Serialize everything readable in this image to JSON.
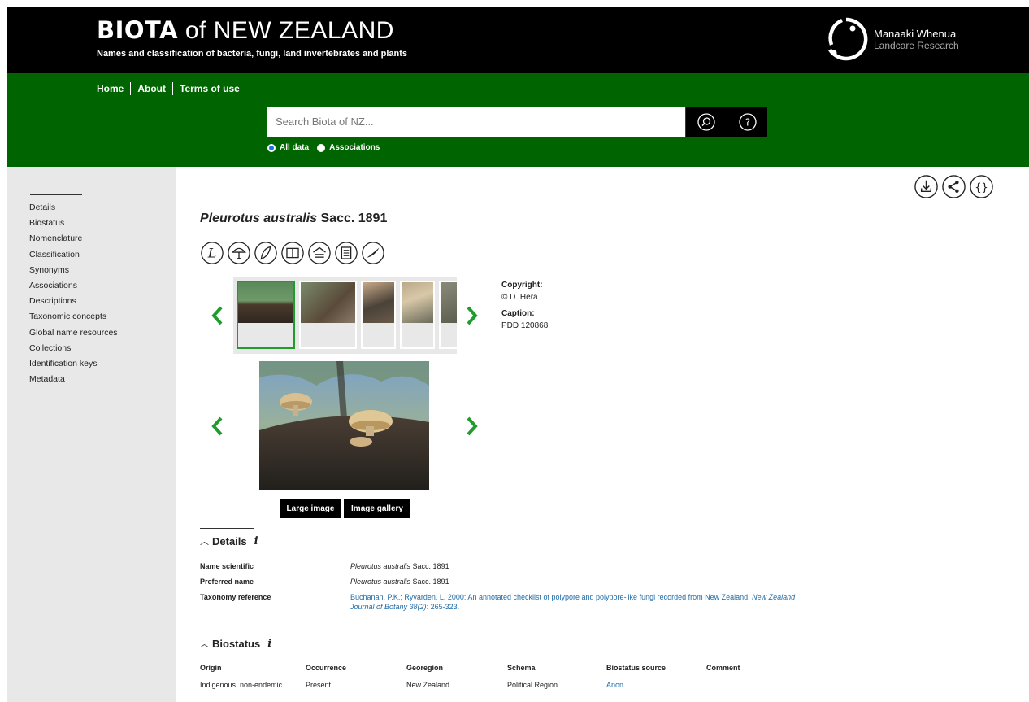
{
  "header": {
    "brand_bold": "BIOTA",
    "brand_rest": " of NEW ZEALAND",
    "subtitle": "Names and classification of bacteria, fungi, land invertebrates and plants",
    "partner_name": "Manaaki Whenua",
    "partner_sub": "Landcare Research"
  },
  "nav": {
    "home": "Home",
    "about": "About",
    "terms": "Terms of use"
  },
  "search": {
    "placeholder": "Search Biota of NZ...",
    "options": [
      "All data",
      "Associations"
    ],
    "selected": "All data"
  },
  "sidebar": {
    "items": [
      "Details",
      "Biostatus",
      "Nomenclature",
      "Classification",
      "Synonyms",
      "Associations",
      "Descriptions",
      "Taxonomic concepts",
      "Global name resources",
      "Collections",
      "Identification keys",
      "Metadata"
    ]
  },
  "taxon": {
    "name_italic": "Pleurotus australis",
    "authority": " Sacc. 1891"
  },
  "image_meta": {
    "copyright_label": "Copyright:",
    "copyright_value": "© D. Hera",
    "caption_label": "Caption:",
    "caption_value": "PDD 120868"
  },
  "buttons": {
    "large_image": "Large image",
    "image_gallery": "Image gallery"
  },
  "details": {
    "heading": "Details",
    "rows": [
      {
        "label": "Name scientific",
        "value_italic": "Pleurotus australis",
        "value_rest": " Sacc. 1891"
      },
      {
        "label": "Preferred name",
        "value_italic": "Pleurotus australis",
        "value_rest": " Sacc. 1891"
      },
      {
        "label": "Taxonomy reference",
        "ref_text": "Buchanan, P.K.; Ryvarden, L. 2000: An annotated checklist of polypore and polypore-like fungi recorded from New Zealand. ",
        "ref_journal": "New Zealand Journal of Botany 38(2)",
        "ref_pages": ": 265-323."
      }
    ]
  },
  "biostatus": {
    "heading": "Biostatus",
    "columns": [
      "Origin",
      "Occurrence",
      "Georegion",
      "Schema",
      "Biostatus source",
      "Comment"
    ],
    "rows": [
      [
        "Indigenous, non-endemic",
        "Present",
        "New Zealand",
        "Political Region",
        "Anon",
        ""
      ]
    ]
  },
  "colors": {
    "header_bg": "#000000",
    "nav_green": "#006400",
    "accent_green": "#1f9c2c",
    "link_blue": "#1f6aa5"
  },
  "icons": [
    "search-icon",
    "help-icon",
    "download-icon",
    "share-icon",
    "json-icon",
    "chevron-left-icon",
    "chevron-right-icon"
  ]
}
